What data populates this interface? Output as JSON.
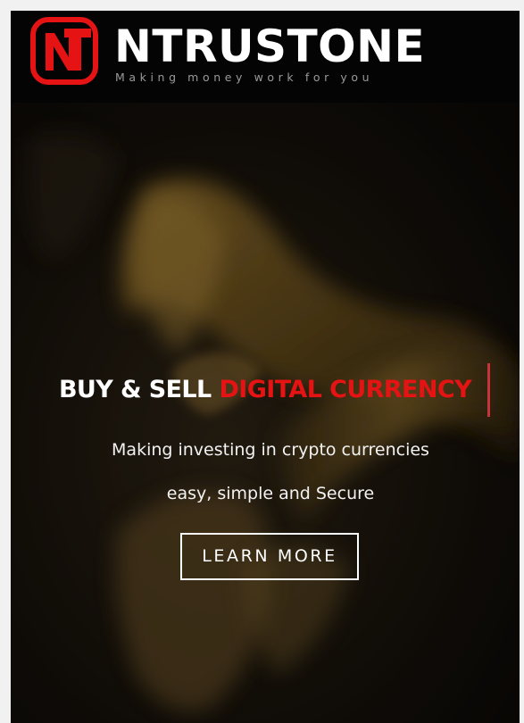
{
  "header": {
    "logo_text": "NT",
    "brand_name": "NTRUSTONE",
    "tagline": "Making money work for you"
  },
  "hero": {
    "headline_white": "BUY & SELL ",
    "headline_red": "DIGITAL CURRENCY",
    "subtitle_line1": "Making investing in crypto currencies",
    "subtitle_line2": "easy, simple and Secure",
    "cta_label": "LEARN MORE"
  },
  "colors": {
    "accent_red": "#e51313",
    "header_bg": "#040404",
    "text": "#ffffff"
  }
}
